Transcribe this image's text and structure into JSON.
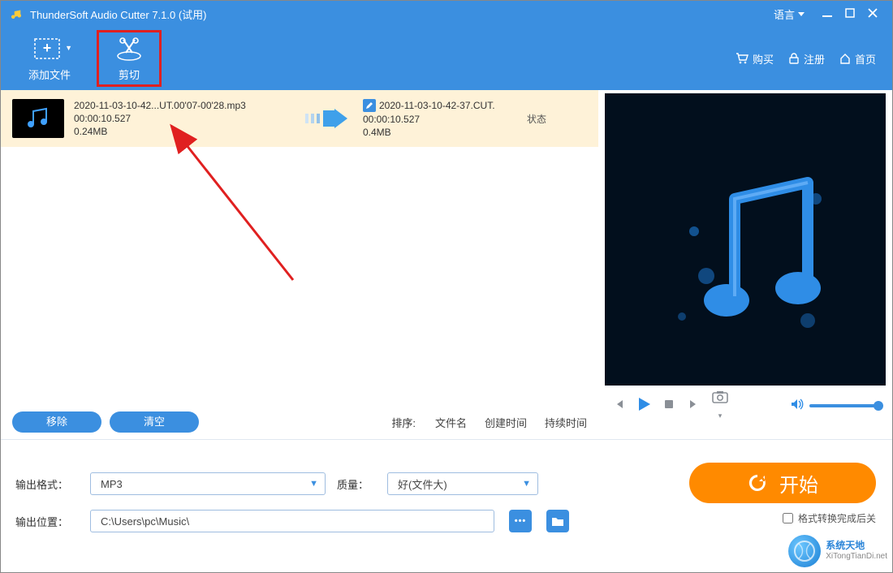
{
  "titlebar": {
    "app_title": "ThunderSoft Audio Cutter 7.1.0 (试用)",
    "language_label": "语言"
  },
  "toolbar": {
    "add_label": "添加文件",
    "cut_label": "剪切",
    "buy_label": "购买",
    "register_label": "注册",
    "home_label": "首页"
  },
  "list": {
    "item": {
      "in_name": "2020-11-03-10-42...UT.00'07-00'28.mp3",
      "in_duration": "00:00:10.527",
      "in_size": "0.24MB",
      "out_name": "2020-11-03-10-42-37.CUT.",
      "out_duration": "00:00:10.527",
      "out_size": "0.4MB"
    },
    "status_header": "状态",
    "remove_label": "移除",
    "clear_label": "清空",
    "sort_label": "排序:",
    "sort_filename": "文件名",
    "sort_created": "创建时间",
    "sort_duration": "持续时间"
  },
  "bottom": {
    "format_label": "输出格式：",
    "format_value": "MP3",
    "quality_label": "质量：",
    "quality_value": "好(文件大)",
    "location_label": "输出位置：",
    "location_value": "C:\\Users\\pc\\Music\\",
    "start_label": "开始",
    "close_after_label": "格式转换完成后关",
    "more_btn": "•••"
  },
  "watermark": {
    "line1": "系统天地",
    "line2": "XiTongTianDi.net"
  }
}
